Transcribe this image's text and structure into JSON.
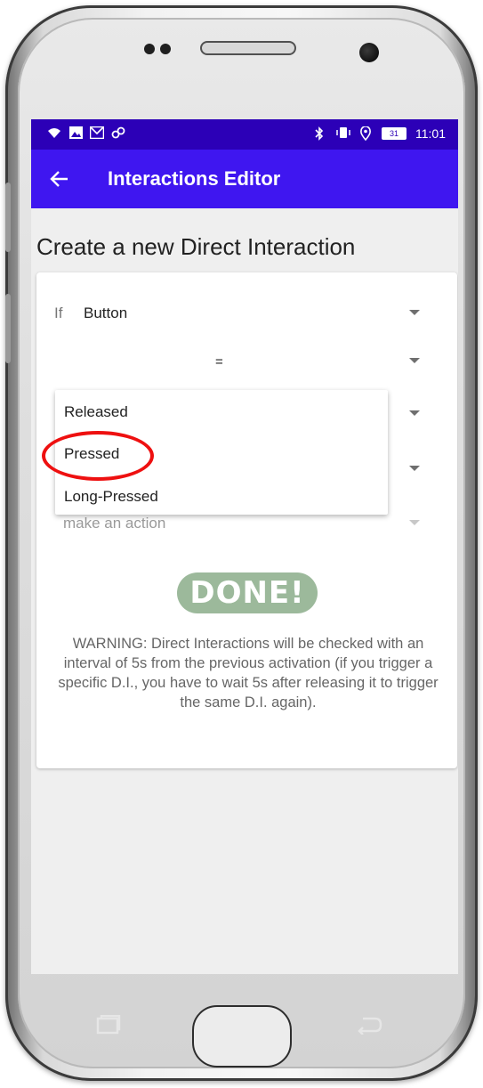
{
  "status_bar": {
    "time": "11:01",
    "battery": "31",
    "left_icons": [
      "wifi-icon",
      "image-icon",
      "gmail-icon",
      "link-icon"
    ],
    "right_icons": [
      "bluetooth-icon",
      "vibrate-icon",
      "location-icon",
      "battery-icon"
    ]
  },
  "app_bar": {
    "title": "Interactions Editor",
    "back_icon": "arrow-left-icon"
  },
  "page": {
    "title": "Create a new Direct Interaction"
  },
  "form": {
    "if_label": "If",
    "trigger_value": "Button",
    "operator_value": "=",
    "action_placeholder": "make an action"
  },
  "dropdown": {
    "options": [
      "Released",
      "Pressed",
      "Long-Pressed"
    ],
    "highlighted": "Pressed"
  },
  "done_button": {
    "label": "DONE!"
  },
  "warning_text": "WARNING: Direct Interactions will be checked with an interval of 5s from the previous activation (if you trigger a specific D.I., you have to wait 5s after releasing it to trigger the same D.I. again).",
  "colors": {
    "status_bar": "#2c00b7",
    "app_bar": "#3f16f0",
    "done_button": "#9cb99b",
    "highlight_circle": "#ee1010",
    "background": "#efefef"
  }
}
